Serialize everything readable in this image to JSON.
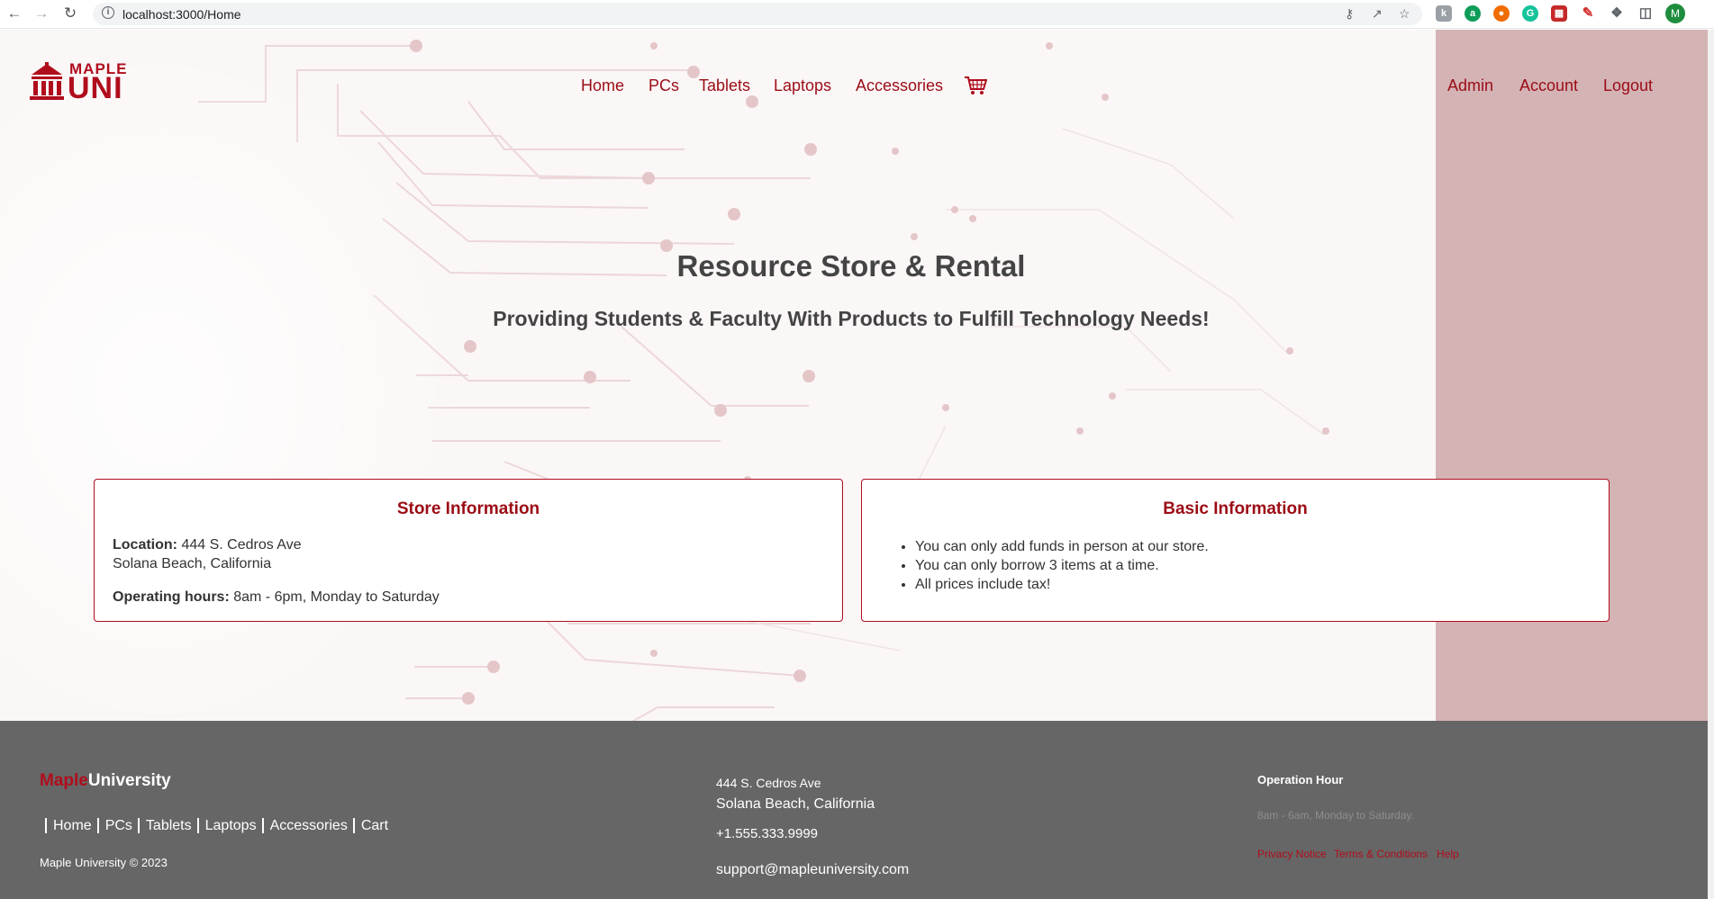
{
  "browser": {
    "url": "localhost:3000/Home"
  },
  "logo": {
    "line1": "MAPLE",
    "line2": "UNI"
  },
  "nav": {
    "items": [
      "Home",
      "PCs",
      "Tablets",
      "Laptops",
      "Accessories"
    ],
    "right": [
      "Admin",
      "Account",
      "Logout"
    ]
  },
  "hero": {
    "title": "Resource Store & Rental",
    "subtitle": "Providing Students & Faculty With Products to Fulfill Technology Needs!"
  },
  "store_info": {
    "title": "Store Information",
    "location_label": "Location:",
    "location_line1": "444 S. Cedros Ave",
    "location_line2": "Solana Beach, California",
    "hours_label": "Operating hours:",
    "hours_value": "8am - 6pm, Monday to Saturday"
  },
  "basic_info": {
    "title": "Basic Information",
    "items": [
      "You can only add funds in person at our store.",
      "You can only borrow 3 items at a time.",
      "All prices include tax!"
    ]
  },
  "footer": {
    "brand_red": "Maple",
    "brand_white": "University",
    "links": [
      "Home",
      "PCs",
      "Tablets",
      "Laptops",
      "Accessories",
      "Cart"
    ],
    "copyright": "Maple University © 2023",
    "address_line1": "444 S. Cedros Ave",
    "address_line2": "Solana Beach, California",
    "phone": "+1.555.333.9999",
    "email": "support@mapleuniversity.com",
    "operation_heading": "Operation Hour",
    "operation_text": "8am - 6am, Monday to Saturday.",
    "legal": [
      "Privacy Notice",
      "Terms & Conditions",
      "Help"
    ]
  },
  "colors": {
    "brand_red": "#b00d1c",
    "footer_bg": "#666666",
    "right_panel": "#d4b3b5"
  }
}
